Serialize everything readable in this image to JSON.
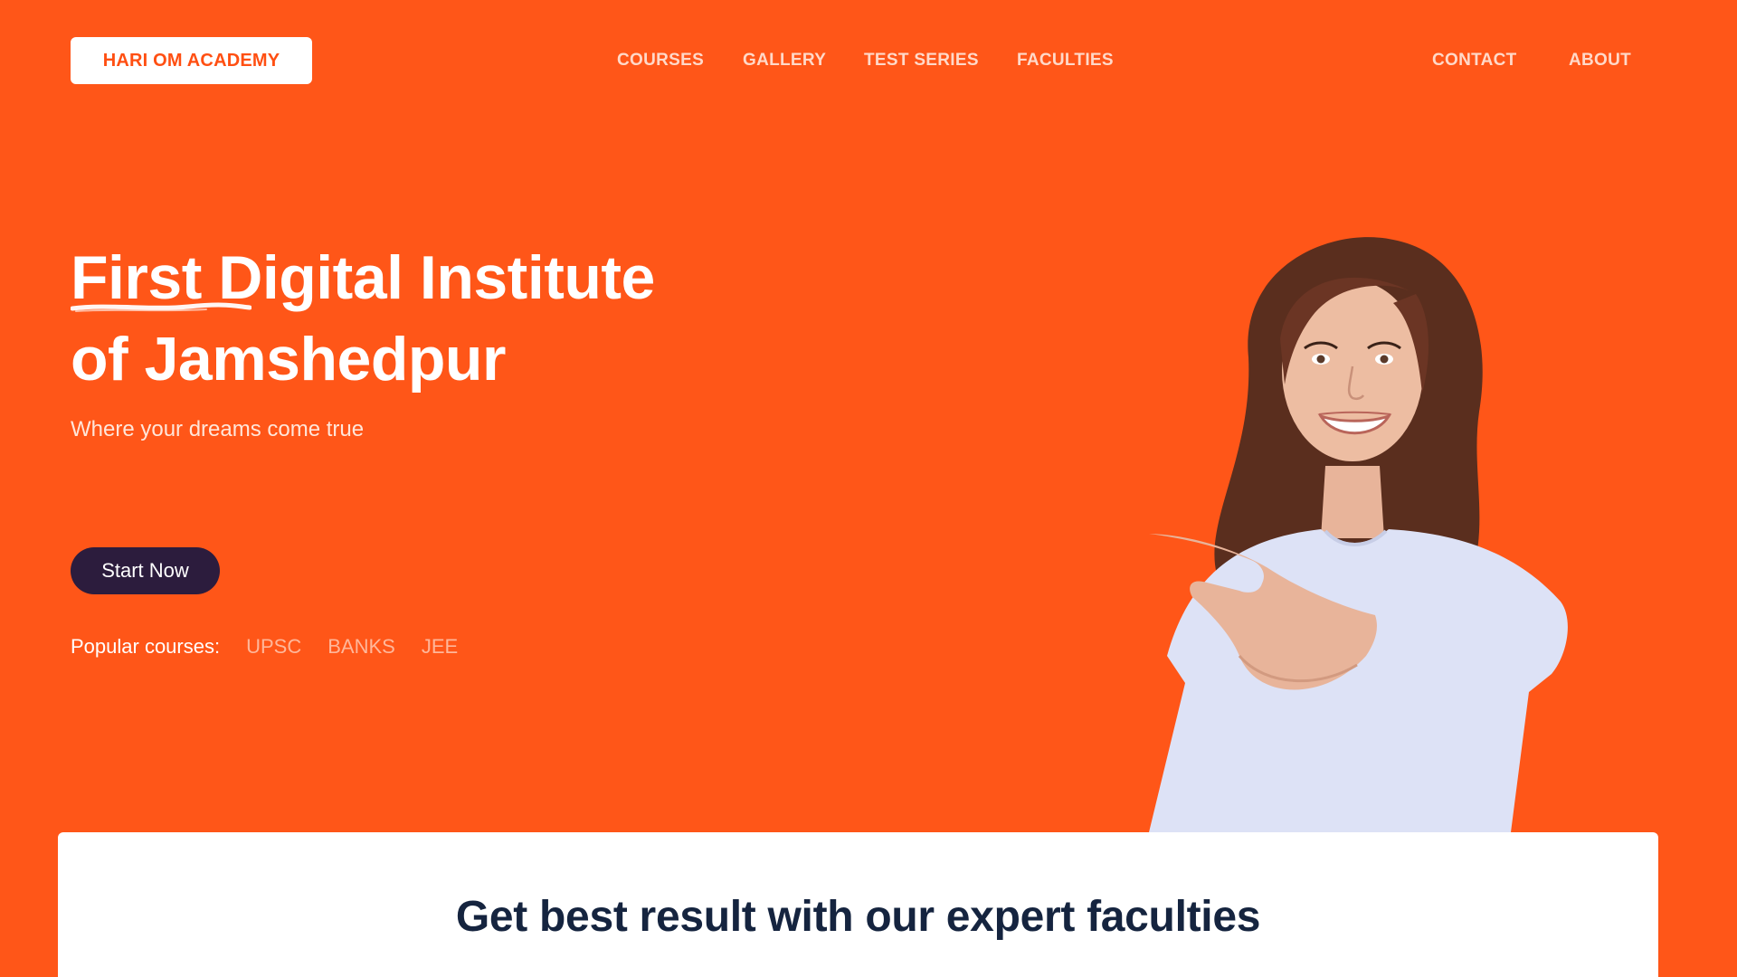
{
  "brand": {
    "logo_label": "HARI OM ACADEMY"
  },
  "nav": {
    "primary": [
      {
        "label": "COURSES"
      },
      {
        "label": "GALLERY"
      },
      {
        "label": "TEST SERIES"
      },
      {
        "label": "FACULTIES"
      }
    ],
    "secondary": [
      {
        "label": "CONTACT"
      },
      {
        "label": "ABOUT"
      }
    ]
  },
  "hero": {
    "title_line1": "First Digital Institute",
    "title_line2": "of Jamshedpur",
    "subtitle": "Where your dreams come true",
    "cta_label": "Start Now",
    "popular_label": "Popular courses:",
    "popular_courses": [
      "UPSC",
      "BANKS",
      "JEE"
    ]
  },
  "section": {
    "title": "Get best result with our expert faculties"
  },
  "colors": {
    "background": "#FF5618",
    "cta_background": "#2C1C3D",
    "card_background": "#FFFFFF",
    "card_title": "#15243F",
    "logo_text": "#FF4F12"
  },
  "icons": {
    "hero_photo": "smiling-student-pointing"
  }
}
